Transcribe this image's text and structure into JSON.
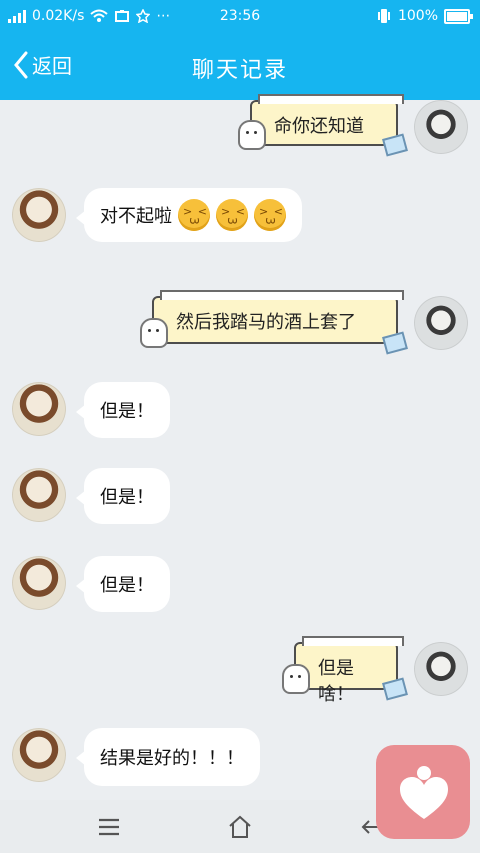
{
  "status_bar": {
    "speed": "0.02K/s",
    "time": "23:56",
    "battery_pct": "100%"
  },
  "header": {
    "back_label": "返回",
    "title": "聊天记录"
  },
  "messages": [
    {
      "side": "me",
      "text": "命你还知道"
    },
    {
      "side": "friend",
      "text": "对不起啦"
    },
    {
      "side": "me",
      "text": "然后我踏马的酒上套了"
    },
    {
      "side": "friend",
      "text": "但是！"
    },
    {
      "side": "friend",
      "text": "但是！"
    },
    {
      "side": "friend",
      "text": "但是！"
    },
    {
      "side": "me",
      "text": "但是啥！"
    },
    {
      "side": "friend",
      "text": "结果是好的！！！"
    }
  ],
  "icons": {
    "status_left": [
      "signal-icon",
      "wifi-icon",
      "usb-icon",
      "star-icon",
      "more-icon"
    ],
    "status_right": [
      "vibrate-icon",
      "battery-icon"
    ],
    "nav": [
      "menu-icon",
      "home-icon",
      "back-arrow-icon"
    ],
    "emoji": "face-emoji-icon",
    "floating": "heart-icon"
  },
  "colors": {
    "header_bg": "#16b5f0",
    "chat_bg": "#ebeef1",
    "friend_bubble": "#ffffff",
    "me_bubble": "#fdf5c9",
    "float_bg": "#e98e92"
  }
}
